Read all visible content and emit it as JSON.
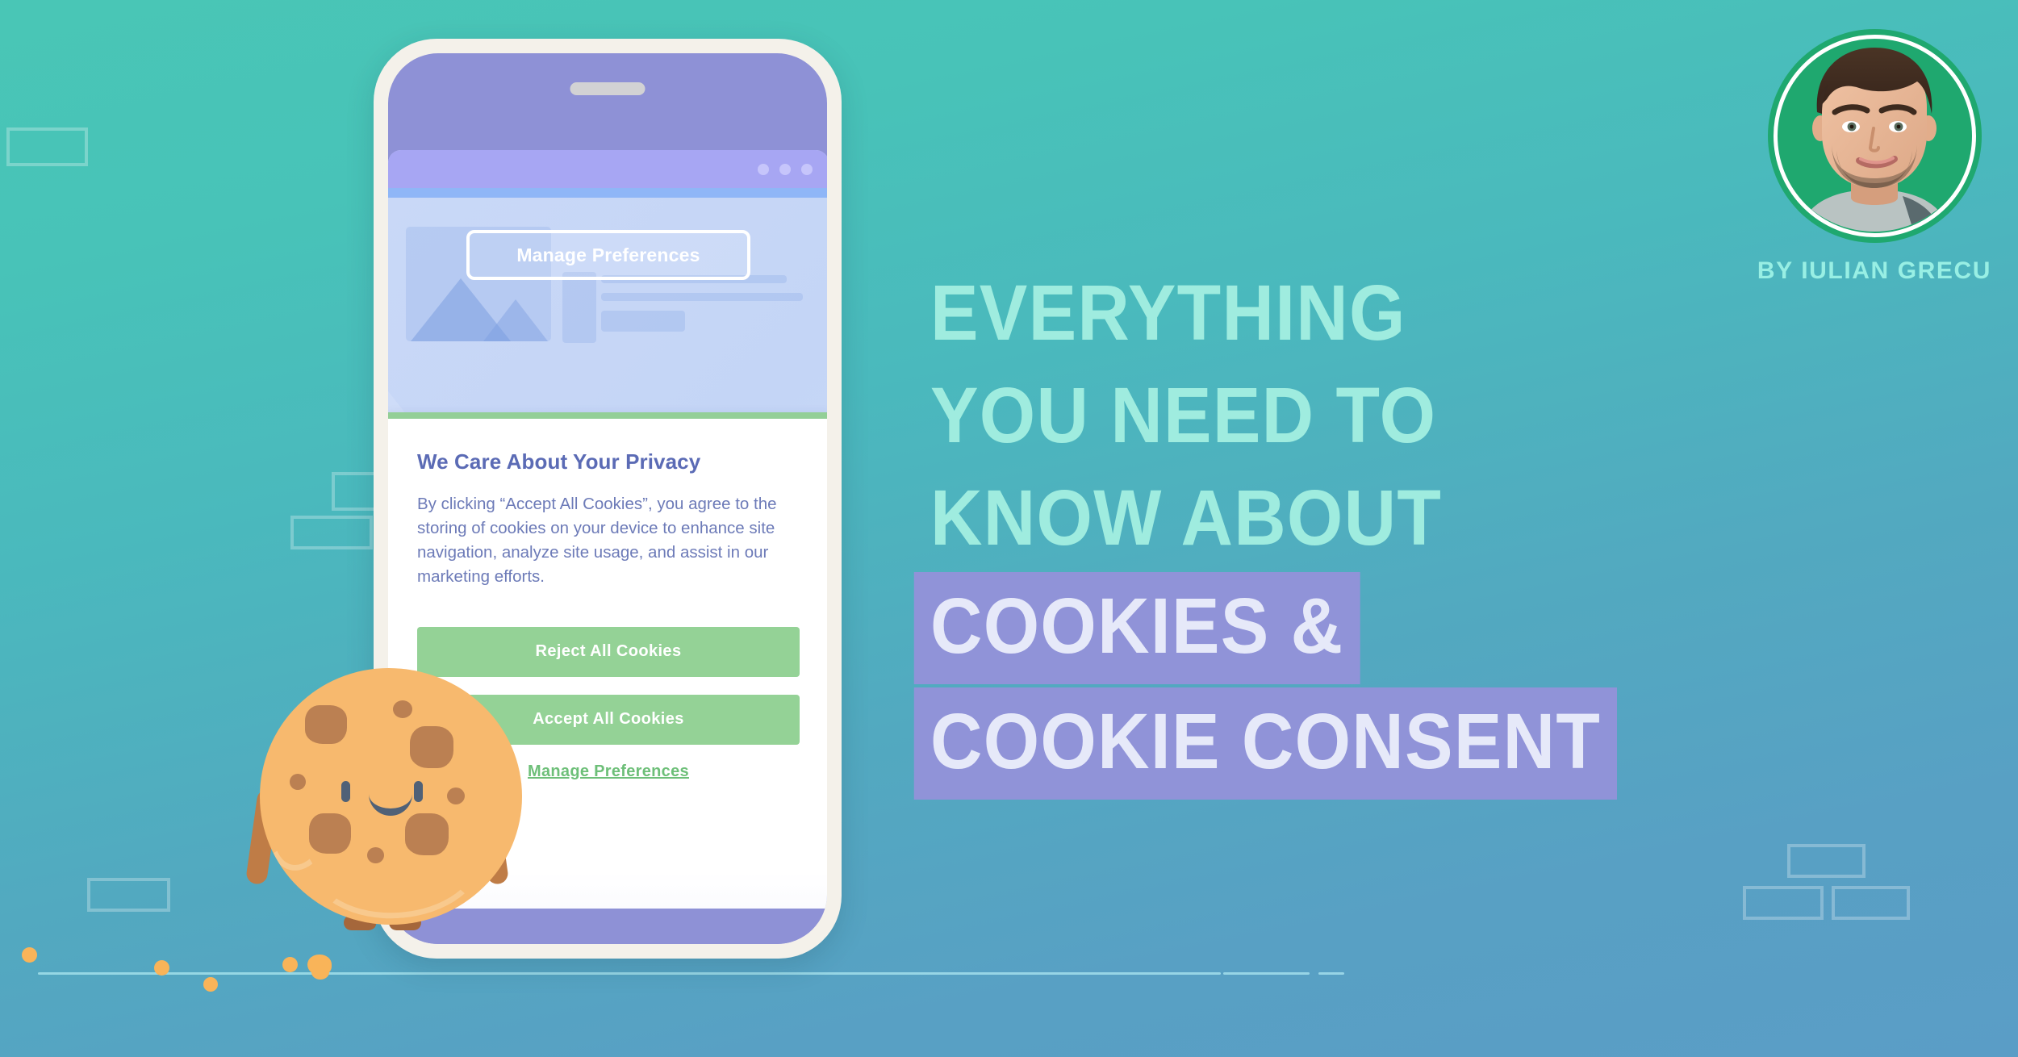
{
  "background": {
    "gradient_top": "#49c6b6",
    "gradient_bottom": "#5a9dc6",
    "deco_rect_color": "#ffffff"
  },
  "headline": {
    "lines": [
      {
        "text": "EVERYTHING",
        "highlighted": false
      },
      {
        "text": "YOU NEED TO",
        "highlighted": false
      },
      {
        "text": "KNOW ABOUT",
        "highlighted": false
      },
      {
        "text": "COOKIES &",
        "highlighted": true
      },
      {
        "text": "COOKIE CONSENT",
        "highlighted": true
      }
    ],
    "plain_color": "#9fecdf",
    "highlight_bg": "#9093d8",
    "highlight_color": "#e6e9f9"
  },
  "author": {
    "byline": "BY IULIAN GRECU",
    "byline_color": "#98efe4",
    "avatar_alt": "author-portrait",
    "avatar_bg": "#1fa86f"
  },
  "phone": {
    "frame_color": "#f4f1ea",
    "screen_color": "#8e91d6",
    "speaker_name": "speaker-grille",
    "browser": {
      "chrome_color": "#a7a6f3",
      "dots": [
        "dot-1",
        "dot-2",
        "dot-3"
      ],
      "top_button_label": "Manage Preferences"
    },
    "consent": {
      "accent_color": "#93cf97",
      "title": "We Care About Your Privacy",
      "body": "By clicking “Accept All Cookies”, you agree to the storing of cookies on your device to enhance site navigation, analyze site usage, and assist in our marketing efforts.",
      "buttons": [
        {
          "label": "Reject All Cookies",
          "style": "green"
        },
        {
          "label": "Accept All Cookies",
          "style": "green"
        }
      ],
      "link_label": "Manage Preferences",
      "link_color": "#6dbf78",
      "button_color": "#94d296",
      "title_color": "#5b6bb5",
      "body_color": "#6d7bb8"
    }
  },
  "cookie_mascot": {
    "name": "cookie-character",
    "body_color": "#f6b25e",
    "chip_color": "#b4723f",
    "limb_color": "#a5673b",
    "face_color": "#3d5068",
    "crumb_color": "#f9b459"
  }
}
